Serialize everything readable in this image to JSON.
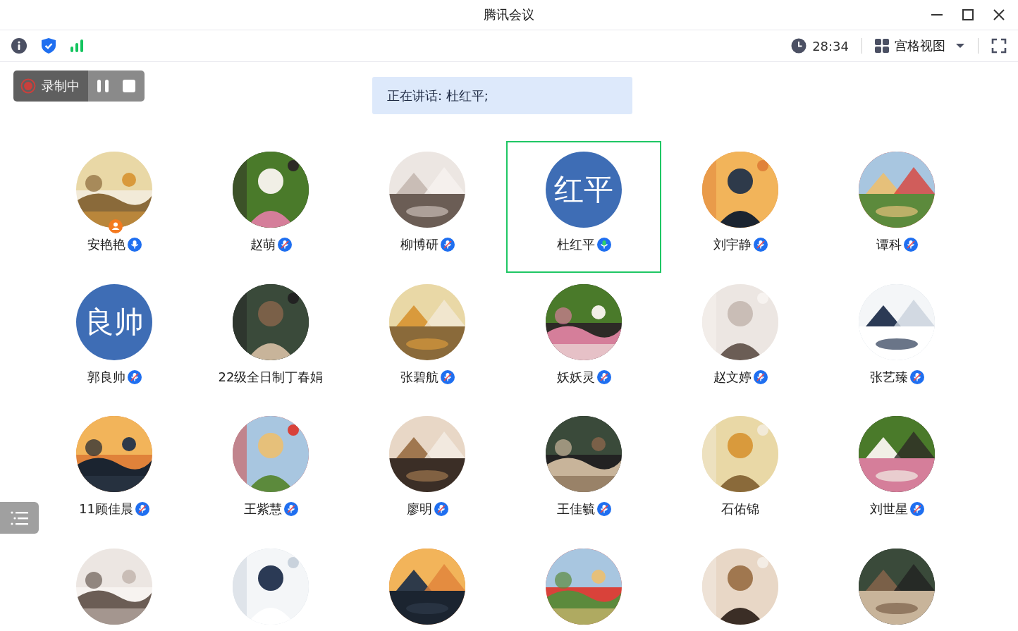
{
  "window": {
    "title": "腾讯会议"
  },
  "toolbar": {
    "duration": "28:34",
    "view_mode": "宫格视图"
  },
  "recording": {
    "label": "录制中"
  },
  "speaking_banner": {
    "text": "正在讲话: 杜红平;"
  },
  "participants": [
    {
      "name": "安艳艳",
      "mic": {
        "muted": false,
        "speaking": false
      },
      "host": true,
      "selected": false
    },
    {
      "name": "赵萌",
      "mic": {
        "muted": true,
        "speaking": false
      },
      "host": false,
      "selected": false
    },
    {
      "name": "柳博研",
      "mic": {
        "muted": true,
        "speaking": false
      },
      "host": false,
      "selected": false
    },
    {
      "name": "杜红平",
      "mic": {
        "muted": false,
        "speaking": true
      },
      "host": false,
      "selected": true,
      "avatar": {
        "kind": "text",
        "text": "红平"
      }
    },
    {
      "name": "刘宇静",
      "mic": {
        "muted": true,
        "speaking": false
      },
      "host": false,
      "selected": false
    },
    {
      "name": "谭科",
      "mic": {
        "muted": true,
        "speaking": false
      },
      "host": false,
      "selected": false
    },
    {
      "name": "郭良帅",
      "mic": {
        "muted": true,
        "speaking": false
      },
      "host": false,
      "selected": false,
      "avatar": {
        "kind": "text",
        "text": "良帅"
      }
    },
    {
      "name": "22级全日制丁春娟",
      "host": false,
      "selected": false
    },
    {
      "name": "张碧航",
      "mic": {
        "muted": true,
        "speaking": false
      },
      "host": false,
      "selected": false
    },
    {
      "name": "妖妖灵",
      "mic": {
        "muted": true,
        "speaking": false
      },
      "host": false,
      "selected": false
    },
    {
      "name": "赵文婷",
      "mic": {
        "muted": true,
        "speaking": false
      },
      "host": false,
      "selected": false
    },
    {
      "name": "张艺臻",
      "mic": {
        "muted": true,
        "speaking": false
      },
      "host": false,
      "selected": false
    },
    {
      "name": "11顾佳晨",
      "mic": {
        "muted": true,
        "speaking": false
      },
      "host": false,
      "selected": false
    },
    {
      "name": "王紫慧",
      "mic": {
        "muted": true,
        "speaking": false
      },
      "host": false,
      "selected": false
    },
    {
      "name": "廖明",
      "mic": {
        "muted": true,
        "speaking": false
      },
      "host": false,
      "selected": false
    },
    {
      "name": "王佳毓",
      "mic": {
        "muted": true,
        "speaking": false
      },
      "host": false,
      "selected": false
    },
    {
      "name": "石佑锦",
      "host": false,
      "selected": false
    },
    {
      "name": "刘世星",
      "mic": {
        "muted": true,
        "speaking": false
      },
      "host": false,
      "selected": false
    },
    {
      "selected": false
    },
    {
      "selected": false
    },
    {
      "selected": false
    },
    {
      "selected": false
    },
    {
      "selected": false
    },
    {
      "selected": false
    }
  ]
}
